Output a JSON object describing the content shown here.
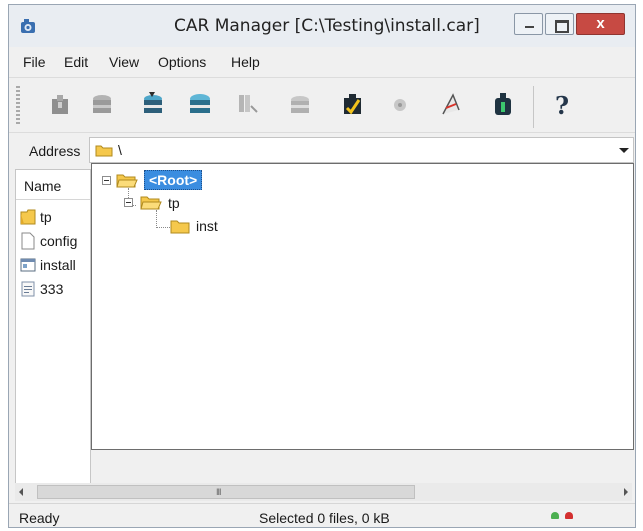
{
  "window": {
    "title": "CAR Manager [C:\\Testing\\install.car]",
    "close_glyph": "x",
    "app_icon": "camera-icon"
  },
  "menu": {
    "items": [
      "File",
      "Edit",
      "View",
      "Options",
      "Help"
    ]
  },
  "toolbar": {
    "buttons": [
      {
        "icon": "package-icon",
        "enabled": false
      },
      {
        "icon": "box-open-icon",
        "enabled": false
      },
      {
        "icon": "box-extract-icon",
        "enabled": true
      },
      {
        "icon": "box-add-icon",
        "enabled": true
      },
      {
        "icon": "pages-icon",
        "enabled": false
      },
      {
        "icon": "box-delete-icon",
        "enabled": false
      },
      {
        "icon": "test-archive-icon",
        "enabled": true
      },
      {
        "icon": "disc-icon",
        "enabled": false
      },
      {
        "icon": "wizard-icon",
        "enabled": true
      },
      {
        "icon": "info-icon",
        "enabled": true
      },
      {
        "icon": "help-icon",
        "enabled": true
      }
    ],
    "help_glyph": "?"
  },
  "address": {
    "label": "Address",
    "value": "\\"
  },
  "list": {
    "column_name": "Name",
    "items": [
      {
        "name": "tp",
        "icon": "folder-icon"
      },
      {
        "name": "config",
        "icon": "file-icon"
      },
      {
        "name": "install",
        "icon": "app-file-icon"
      },
      {
        "name": "333",
        "icon": "text-file-icon"
      }
    ]
  },
  "tree": {
    "root_label": "<Root>",
    "children": [
      {
        "label": "tp",
        "children": [
          {
            "label": "inst"
          }
        ]
      }
    ]
  },
  "scrollbar": {
    "grip": "III"
  },
  "status": {
    "left": "Ready",
    "middle": "Selected 0 files, 0 kB",
    "indicator_colors": [
      "#4caf50",
      "#d32f2f"
    ]
  },
  "colors": {
    "selection": "#3b8de0",
    "close_button": "#c74a43",
    "folder": "#f5c84c"
  }
}
